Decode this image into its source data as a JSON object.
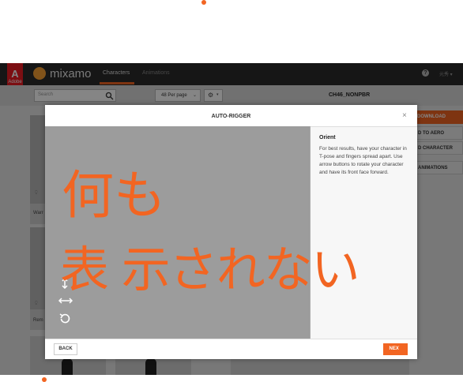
{
  "app": {
    "brand": "mixamo",
    "adobe_logo_text": "Adobe",
    "adobe_logo_glyph": "A",
    "tabs": [
      {
        "label": "Characters",
        "active": true
      },
      {
        "label": "Animations",
        "active": false
      }
    ],
    "help_glyph": "?",
    "user_name": "元秀 ▾",
    "accent_color": "#f26522"
  },
  "toolbar": {
    "search_placeholder": "Search",
    "per_page": "48 Per page",
    "per_page_chevron": "⌄",
    "settings_glyph": "⚙",
    "settings_chevron": "▾",
    "character_name": "CH46_NONPBR"
  },
  "cards": [
    {
      "label": "Warr"
    },
    {
      "label": "Rem"
    }
  ],
  "side_buttons": {
    "download": "DOWNLOAD",
    "aero": "D TO AERO",
    "character": "D CHARACTER",
    "animations": "ANIMATIONS"
  },
  "modal": {
    "title": "AUTO-RIGGER",
    "close_glyph": "×",
    "panel_heading": "Orient",
    "panel_text": "For best results, have your character in T-pose and fingers spread apart. Use arrow buttons to rotate your character and have its front face forward.",
    "back_label": "BACK",
    "next_label": "NEXT"
  },
  "annotation": {
    "line1": "何も",
    "line2": "表 示されない",
    "color": "#f26522"
  }
}
